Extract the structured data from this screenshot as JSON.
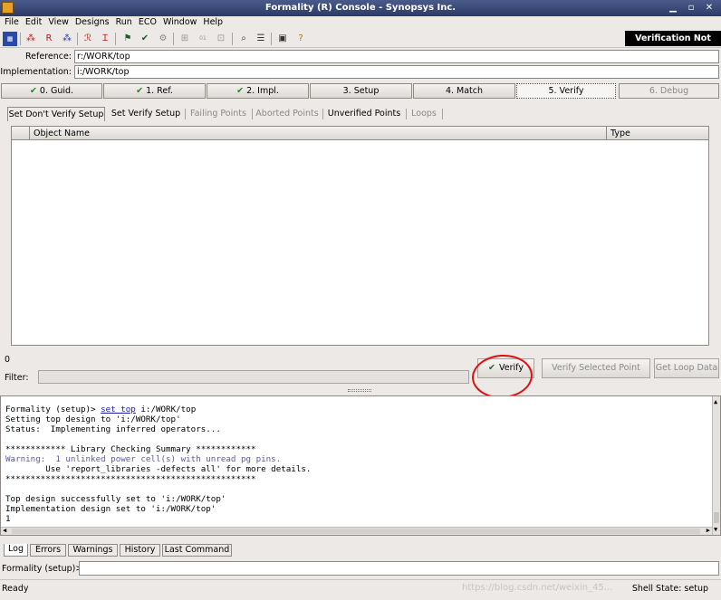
{
  "window": {
    "title": "Formality (R) Console - Synopsys Inc."
  },
  "menu": [
    "File",
    "Edit",
    "View",
    "Designs",
    "Run",
    "ECO",
    "Window",
    "Help"
  ],
  "toolbar": {
    "status": "Verification Not Run"
  },
  "design": {
    "reference_label": "Reference:",
    "reference_value": "r:/WORK/top",
    "implementation_label": "Implementation:",
    "implementation_value": "i:/WORK/top"
  },
  "steps": [
    {
      "label": "0. Guid.",
      "done": true
    },
    {
      "label": "1. Ref.",
      "done": true
    },
    {
      "label": "2. Impl.",
      "done": true
    },
    {
      "label": "3. Setup",
      "done": false
    },
    {
      "label": "4. Match",
      "done": false
    },
    {
      "label": "5. Verify",
      "done": false,
      "active": true
    },
    {
      "label": "6. Debug",
      "done": false,
      "disabled": true
    }
  ],
  "subtabs": [
    "Set Don't Verify Setup",
    "Set Verify Setup",
    "Failing Points",
    "Aborted Points",
    "Unverified Points",
    "Loops"
  ],
  "table": {
    "columns": [
      "Object Name",
      "Type"
    ],
    "count": "0"
  },
  "filter": {
    "label": "Filter:"
  },
  "buttons": {
    "verify": "Verify",
    "verify_selected": "Verify Selected Point",
    "get_loop": "Get Loop Data"
  },
  "log": {
    "lines": [
      "Formality (setup)> ",
      "set_top",
      " i:/WORK/top",
      "Setting top design to 'i:/WORK/top'",
      "Status:  Implementing inferred operators...",
      "",
      "************ Library Checking Summary ************",
      "Warning:  1 unlinked power cell(s) with unread pg pins.",
      "        Use 'report_libraries -defects all' for more details.",
      "**************************************************",
      "",
      "",
      "Top design successfully set to 'i:/WORK/top'",
      "Implementation design set to 'i:/WORK/top'",
      "1"
    ]
  },
  "log_tabs": [
    "Log",
    "Errors",
    "Warnings",
    "History",
    "Last Command"
  ],
  "prompt": "Formality (setup)>",
  "statusbar": {
    "left": "Ready",
    "right": "Shell State: setup",
    "watermark": "https://blog.csdn.net/weixin_45..."
  }
}
